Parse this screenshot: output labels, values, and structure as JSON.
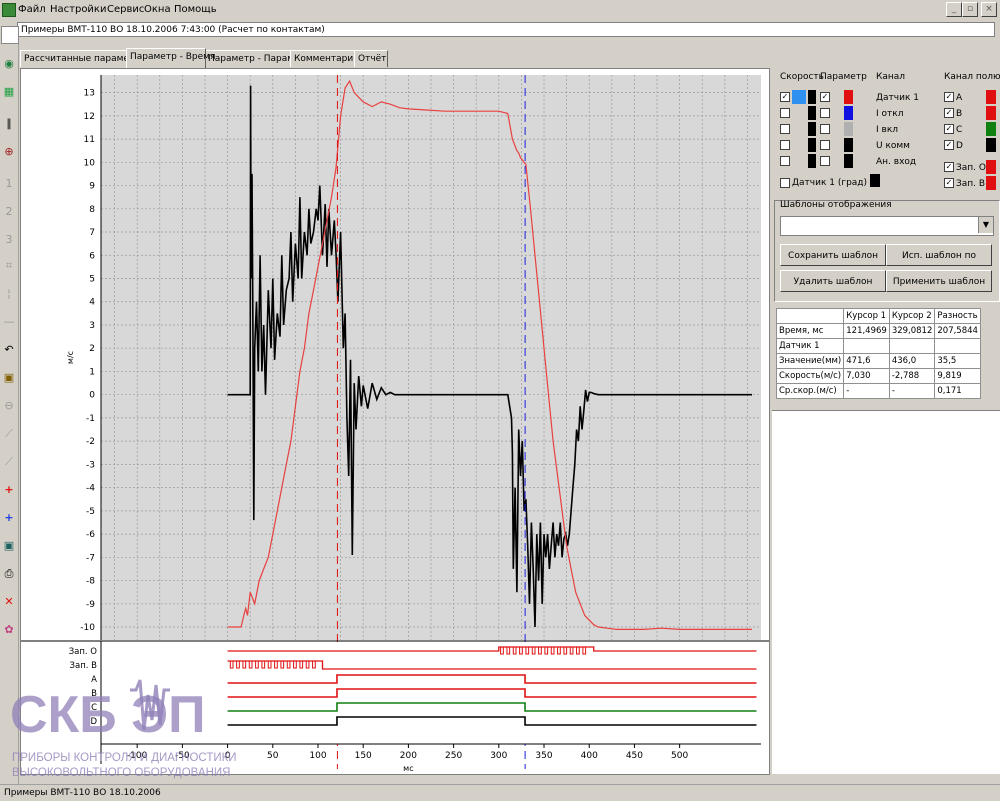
{
  "menu": {
    "items": [
      "Файл",
      "Настройки",
      "Сервис",
      "Окна",
      "Помощь"
    ]
  },
  "window_controls": {
    "minimize": "_",
    "restore": "▫",
    "close": "×"
  },
  "document": {
    "title": "Примеры ВМТ-110 ВО 18.10.2006 7:43:00 (Расчет по контактам)"
  },
  "toolbar": {
    "icons": [
      "document-icon",
      "globe-icon",
      "stack-icon",
      "pause-icon",
      "zoom-icon",
      "cursor1-icon",
      "cursor2-icon",
      "cursor3-icon",
      "crop-icon",
      "split-icon",
      "minus-icon",
      "undo-icon",
      "lock-icon",
      "zoom-out-icon",
      "graph1-icon",
      "graph2-icon",
      "add-red-icon",
      "add-blue-icon",
      "frame-icon",
      "print-icon",
      "delete-icon",
      "palette-icon"
    ]
  },
  "tabs": [
    {
      "label": "Рассчитанные параметры",
      "active": false
    },
    {
      "label": "Параметр - Время",
      "active": true
    },
    {
      "label": "Параметр - Параметр",
      "active": false
    },
    {
      "label": "Комментарий",
      "active": false
    },
    {
      "label": "Отчёт",
      "active": false
    }
  ],
  "right_panel": {
    "headers": {
      "speed": "Скорость",
      "param": "Параметр",
      "channel": "Канал",
      "pole_channel": "Канал полюса"
    },
    "channels": [
      {
        "name": "Датчик 1",
        "speed_checked": true,
        "param_checked": true
      },
      {
        "name": "I откл",
        "speed_checked": false,
        "param_checked": false
      },
      {
        "name": "I вкл",
        "speed_checked": false,
        "param_checked": false
      },
      {
        "name": "U комм",
        "speed_checked": false,
        "param_checked": false
      },
      {
        "name": "Ан. вход",
        "speed_checked": false,
        "param_checked": false
      }
    ],
    "degree_option": "Датчик 1 (град)",
    "pole_channels": [
      {
        "name": "A",
        "checked": true,
        "color": "#e01010"
      },
      {
        "name": "B",
        "checked": true,
        "color": "#e01010"
      },
      {
        "name": "C",
        "checked": true,
        "color": "#108010"
      },
      {
        "name": "D",
        "checked": true,
        "color": "#000000"
      },
      {
        "name": "Зап. О",
        "checked": true,
        "color": "#e01010"
      },
      {
        "name": "Зап. В",
        "checked": true,
        "color": "#e01010"
      }
    ],
    "templates_title": "Шаблоны отображения",
    "buttons": {
      "save": "Сохранить шаблон как...",
      "use_default": "Исп. шаблон по умолч.",
      "delete": "Удалить шаблон",
      "apply": "Применить шаблон"
    },
    "table": {
      "headers": [
        "",
        "Курсор 1",
        "Курсор 2",
        "Разность"
      ],
      "rows": [
        [
          "Время, мс",
          "121,4969",
          "329,0812",
          "207,5844"
        ],
        [
          "Датчик 1",
          "",
          "",
          ""
        ],
        [
          "Значение(мм)",
          "471,6",
          "436,0",
          "35,5"
        ],
        [
          "Скорость(м/с)",
          "7,030",
          "-2,788",
          "9,819"
        ],
        [
          "Ср.скор.(м/с)",
          "-",
          "-",
          "0,171"
        ]
      ]
    }
  },
  "chart_data": {
    "type": "line",
    "ylabel": "м/с",
    "xlabel": "мс",
    "xlim": [
      -140,
      590
    ],
    "ylim": [
      -10.3,
      13.5
    ],
    "x_ticks": [
      -100,
      -50,
      0,
      50,
      100,
      150,
      200,
      250,
      300,
      350,
      400,
      450,
      500
    ],
    "y_ticks": [
      13,
      12,
      11,
      10,
      9,
      8,
      7,
      6,
      5,
      4,
      3,
      2,
      1,
      0,
      -1,
      -2,
      -3,
      -4,
      -5,
      -6,
      -7,
      -8,
      -9,
      -10
    ],
    "grid": true,
    "cursors": [
      {
        "name": "Курсор 1",
        "x": 121.5,
        "color": "#e01010"
      },
      {
        "name": "Курсор 2",
        "x": 329.1,
        "color": "#2020e0"
      }
    ],
    "series": [
      {
        "name": "Скорость",
        "color": "#000000",
        "x": [
          0,
          25,
          25.5,
          26,
          27,
          28,
          29,
          30,
          32,
          34,
          36,
          38,
          40,
          42,
          45,
          48,
          50,
          52,
          55,
          58,
          60,
          62,
          65,
          68,
          70,
          72,
          75,
          78,
          80,
          82,
          85,
          88,
          90,
          92,
          95,
          98,
          100,
          102,
          105,
          108,
          110,
          112,
          115,
          118,
          120,
          122,
          125,
          128,
          130,
          132,
          134,
          136,
          138,
          140,
          142,
          145,
          148,
          150,
          155,
          160,
          165,
          170,
          175,
          180,
          185,
          190,
          195,
          200,
          210,
          220,
          230,
          240,
          250,
          260,
          270,
          280,
          290,
          300,
          310,
          314,
          315,
          316,
          318,
          320,
          322,
          324,
          326,
          328,
          330,
          332,
          334,
          336,
          338,
          340,
          342,
          344,
          346,
          348,
          350,
          352,
          354,
          356,
          358,
          360,
          362,
          364,
          366,
          368,
          370,
          372,
          374,
          376,
          378,
          380,
          382,
          384,
          386,
          388,
          390,
          392,
          394,
          396,
          398,
          400,
          402,
          405,
          410,
          415,
          420,
          430,
          440,
          460,
          480,
          500,
          520,
          540,
          560,
          580
        ],
        "values": [
          0,
          0,
          13.3,
          5,
          9.5,
          3,
          -5.4,
          2,
          4,
          1,
          6,
          1,
          3,
          0,
          4.5,
          2,
          5,
          1.5,
          3.5,
          2.5,
          6,
          3,
          4.5,
          5,
          7,
          4,
          6.5,
          5,
          8.5,
          5,
          7,
          6,
          8,
          6.5,
          7,
          8,
          7.5,
          9,
          6,
          8.2,
          5.5,
          8,
          6,
          7.5,
          6,
          4,
          7,
          2,
          3.5,
          -1,
          -3.5,
          1.5,
          -6.9,
          0.5,
          -1.5,
          0.8,
          -0.5,
          0.4,
          -0.6,
          0.5,
          -0.2,
          0.3,
          0,
          0.1,
          0,
          0,
          0,
          0,
          0,
          0,
          0,
          0,
          0,
          0,
          0,
          0,
          0,
          0,
          0,
          -1,
          -2.5,
          -7.5,
          -4,
          -8.5,
          -1.5,
          -3.5,
          -2,
          -5,
          -4.5,
          -6.5,
          -9,
          -5.5,
          -7.5,
          -10,
          -6,
          -8,
          -5.5,
          -9,
          -6,
          -7,
          -6,
          -7.5,
          -6.5,
          -5.5,
          -7,
          -6,
          -6.5,
          -5.5,
          -7,
          -6.2,
          -6,
          -6.5,
          -6,
          -5,
          -4,
          -3,
          -1.5,
          -2,
          -0.5,
          -1.5,
          -0.7,
          0.2,
          -0.3,
          0.1,
          0.1,
          0.05,
          0,
          0,
          0,
          0,
          0,
          0,
          0,
          0,
          0,
          0,
          0,
          0
        ]
      },
      {
        "name": "Параметр",
        "color": "#e84040",
        "x": [
          0,
          15,
          18,
          20,
          22,
          25,
          30,
          35,
          40,
          45,
          50,
          55,
          60,
          65,
          70,
          75,
          80,
          85,
          90,
          95,
          100,
          105,
          110,
          115,
          120,
          125,
          130,
          135,
          140,
          145,
          150,
          155,
          160,
          170,
          180,
          190,
          200,
          220,
          240,
          260,
          280,
          300,
          310,
          315,
          318,
          320,
          322,
          324,
          326,
          328,
          330,
          335,
          340,
          345,
          350,
          355,
          360,
          365,
          370,
          375,
          380,
          385,
          390,
          395,
          400,
          405,
          410,
          420,
          430,
          440,
          460,
          480,
          500,
          520,
          540,
          560,
          580
        ],
        "values": [
          -10,
          -10,
          -9.5,
          -9.2,
          -9.5,
          -8.5,
          -9,
          -8,
          -7.5,
          -7,
          -6,
          -5,
          -4,
          -3,
          -2,
          -0.5,
          1,
          2,
          3.5,
          4.5,
          5.5,
          6.5,
          7.5,
          8.5,
          9.8,
          12,
          13.2,
          13.5,
          13,
          12.8,
          12.6,
          12.5,
          12.4,
          12.6,
          12.5,
          12.35,
          12.3,
          12.25,
          12.2,
          12.2,
          12.2,
          12.2,
          12.1,
          11,
          10.7,
          10.5,
          10.4,
          10.2,
          10.1,
          10,
          9.9,
          8,
          6,
          4,
          2,
          0,
          -2,
          -3.5,
          -5,
          -6.5,
          -7.5,
          -8.5,
          -9,
          -9.5,
          -9.7,
          -9.9,
          -10,
          -10.05,
          -10.1,
          -10.1,
          -10.1,
          -10.05,
          -10.1,
          -10.1,
          -10.1,
          -10.1,
          -10.1
        ]
      }
    ],
    "lower_panel": {
      "labels": [
        "Зап. О",
        "Зап. В",
        "A",
        "B",
        "C",
        "D"
      ],
      "x_tick_labels": [
        "-100",
        "-50",
        "0",
        "50",
        "100",
        "150",
        "200",
        "250",
        "300",
        "350",
        "400",
        "450",
        "500"
      ],
      "xlabel": "мс"
    }
  },
  "watermark": {
    "brand": "СКБ ЭП",
    "line1": "ПРИБОРЫ КОНТРОЛЯ И ДИАГНОСТИКИ",
    "line2": "ВЫСОКОВОЛЬТНОГО ОБОРУДОВАНИЯ"
  },
  "status": {
    "text": "Примеры ВМТ-110 ВО 18.10.2006"
  }
}
